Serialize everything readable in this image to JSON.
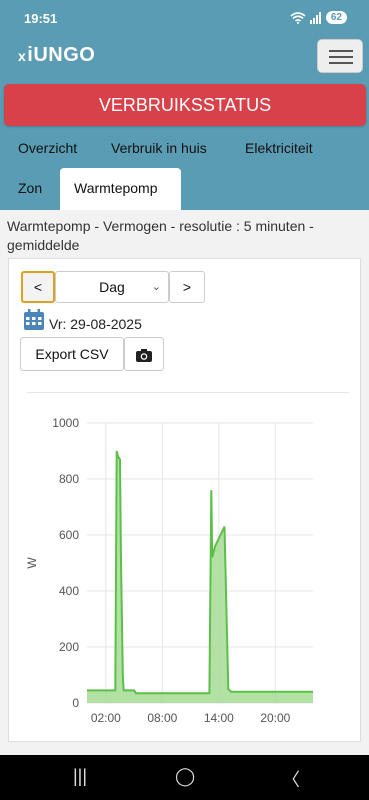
{
  "status_bar": {
    "time": "19:51",
    "battery": "62"
  },
  "app": {
    "logo": "iUNGO",
    "logo_mark": "x"
  },
  "banner": {
    "label": "VERBRUIKSSTATUS"
  },
  "tabs_row1": [
    "Overzicht",
    "Verbruik in huis",
    "Elektriciteit"
  ],
  "tabs_row2": [
    "Zon",
    "Warmtepomp"
  ],
  "active_tab": "Warmtepomp",
  "panel": {
    "title": "Warmtepomp - Vermogen - resolutie : 5 minuten - gemiddelde",
    "prev_label": "<",
    "next_label": ">",
    "period_select": "Dag",
    "date_label": "Vr: 29-08-2025",
    "export_label": "Export CSV"
  },
  "chart_data": {
    "type": "area",
    "ylabel": "W",
    "xlabel": "",
    "x_ticks": [
      "02:00",
      "08:00",
      "14:00",
      "20:00"
    ],
    "y_ticks": [
      0,
      200,
      400,
      600,
      800,
      1000
    ],
    "ylim": [
      0,
      1000
    ],
    "xlim_hours": [
      0,
      24
    ],
    "color": "#5bbf4a",
    "fill": "#a6dc94",
    "grid": true,
    "series": [
      {
        "x": [
          0,
          3.0,
          3.15,
          3.3,
          3.5,
          3.6,
          3.8,
          3.9,
          4.05,
          4.2,
          5.0,
          5.2,
          13.0,
          13.2,
          13.3,
          13.6,
          14.6,
          15.0,
          15.3,
          24
        ],
        "y": [
          45,
          45,
          900,
          880,
          870,
          530,
          100,
          45,
          45,
          45,
          45,
          35,
          35,
          760,
          520,
          560,
          630,
          50,
          40,
          40
        ]
      }
    ]
  },
  "colors": {
    "background": "#5a9cb3",
    "banner": "#d9414a",
    "accent": "#5bbf4a"
  },
  "navbar": {
    "recent": "|||",
    "home": "◯",
    "back": "〈"
  }
}
